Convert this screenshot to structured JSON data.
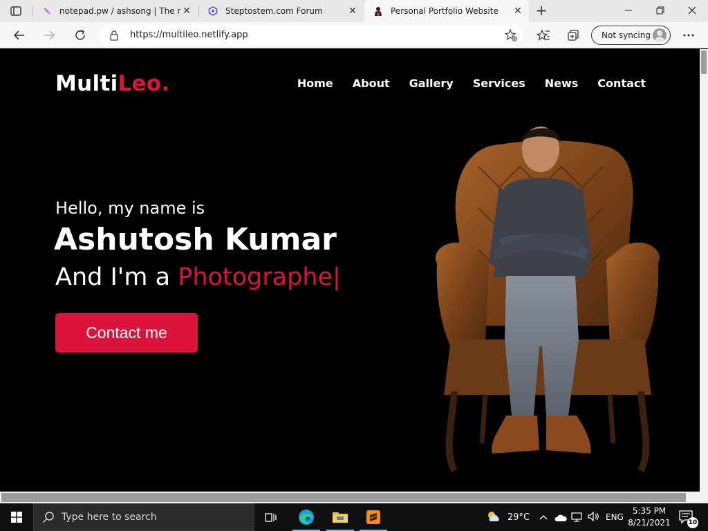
{
  "browser": {
    "tabs": [
      {
        "title": "notepad.pw / ashsong | The napkin of the internet",
        "icon": "notepad-pw-icon"
      },
      {
        "title": "Steptostem.com Forum",
        "icon": "forum-icon"
      },
      {
        "title": "Personal Portfolio Website",
        "icon": "portfolio-icon"
      }
    ],
    "new_tab": "+",
    "address": "https://multileo.netlify.app",
    "sync_label": "Not syncing"
  },
  "site": {
    "logo_main": "Multi",
    "logo_accent": "Leo.",
    "nav": [
      "Home",
      "About",
      "Gallery",
      "Services",
      "News",
      "Contact"
    ],
    "hello": "Hello, my name is",
    "name": "Ashutosh Kumar",
    "role_prefix": "And I'm a ",
    "role_typed": "Photographe",
    "role_caret": "|",
    "cta": "Contact me"
  },
  "taskbar": {
    "search_placeholder": "Type here to search",
    "weather": "29°C",
    "language": "ENG",
    "time": "5:35 PM",
    "date": "8/21/2021",
    "notifications": "10"
  },
  "colors": {
    "accent": "#dc143c",
    "page_bg": "#000000"
  }
}
